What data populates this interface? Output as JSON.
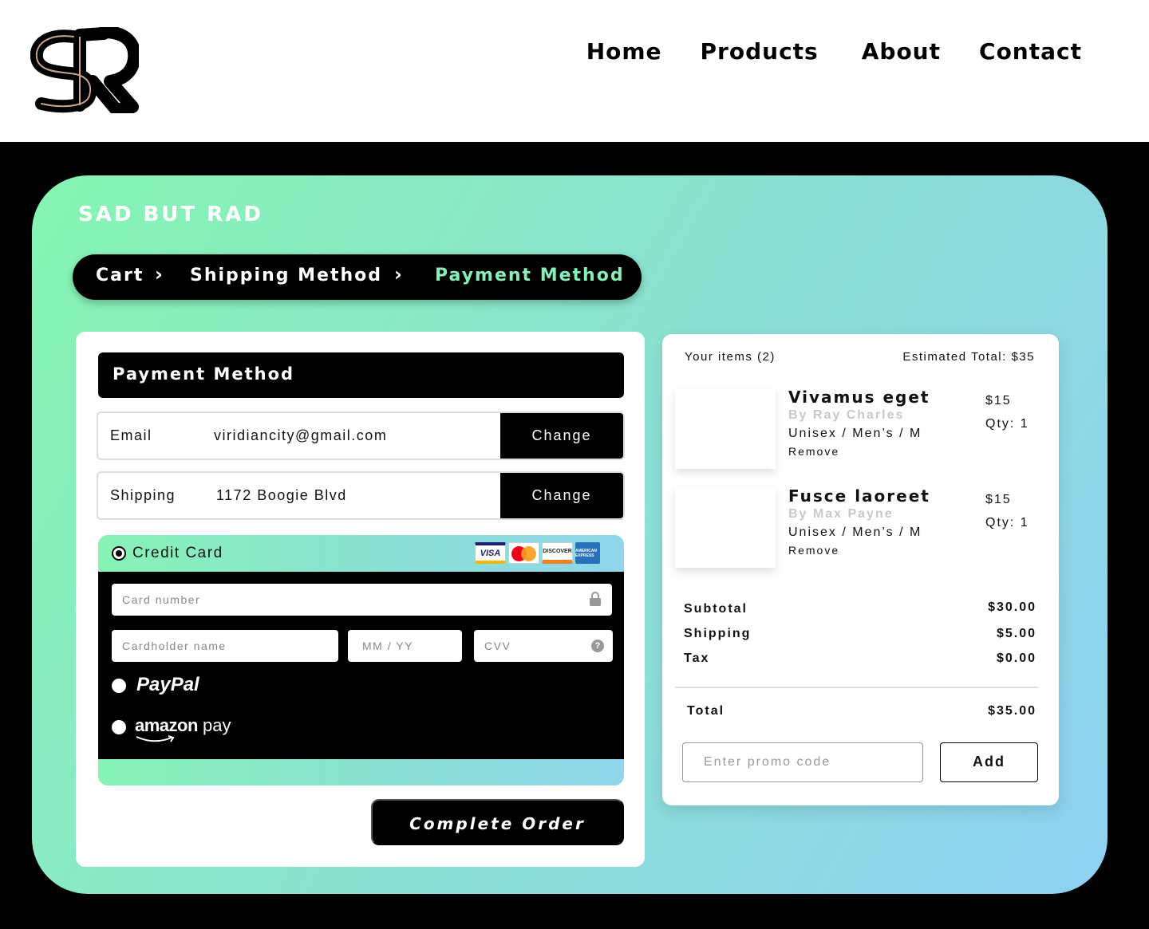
{
  "nav": {
    "home": "Home",
    "products": "Products",
    "about": "About",
    "contact": "Contact"
  },
  "brand": "SAD BUT RAD",
  "breadcrumb": {
    "cart": "Cart",
    "shipping": "Shipping Method",
    "payment": "Payment Method"
  },
  "payment": {
    "header": "Payment Method",
    "email_label": "Email",
    "email_value": "viridiancity@gmail.com",
    "shipping_label": "Shipping",
    "shipping_value": "1172 Boogie Blvd",
    "change_label": "Change",
    "credit_card_label": "Credit Card",
    "card_number_placeholder": "Card number",
    "cardholder_placeholder": "Cardholder name",
    "expiry_placeholder": "MM / YY",
    "cvv_placeholder": "CVV",
    "paypal_label": "PayPal",
    "amazon_label_brand": "amazon",
    "amazon_label_pay": "pay",
    "complete_label": "Complete Order",
    "card_brands": [
      "VISA",
      "MasterCard",
      "DISCOVER",
      "AMERICAN EXPRESS"
    ]
  },
  "summary": {
    "items_count": "Your items (2)",
    "estimated_total": "Estimated Total: $35",
    "items": [
      {
        "name": "Vivamus eget",
        "by": "By Ray Charles",
        "variant": "Unisex / Men’s / M",
        "remove": "Remove",
        "price": "$15",
        "qty": "Qty: 1"
      },
      {
        "name": "Fusce laoreet",
        "by": "By Max Payne",
        "variant": "Unisex / Men’s / M",
        "remove": "Remove",
        "price": "$15",
        "qty": "Qty: 1"
      }
    ],
    "subtotal_label": "Subtotal",
    "subtotal_value": "$30.00",
    "shipping_label": "Shipping",
    "shipping_value": "$5.00",
    "tax_label": "Tax",
    "tax_value": "$0.00",
    "total_label": "Total",
    "total_value": "$35.00",
    "promo_placeholder": "Enter promo code",
    "add_label": "Add"
  },
  "colors": {
    "accent_green": "#86f0b9",
    "gradient_start": "#86f5b2",
    "gradient_end": "#8ed0f2"
  }
}
